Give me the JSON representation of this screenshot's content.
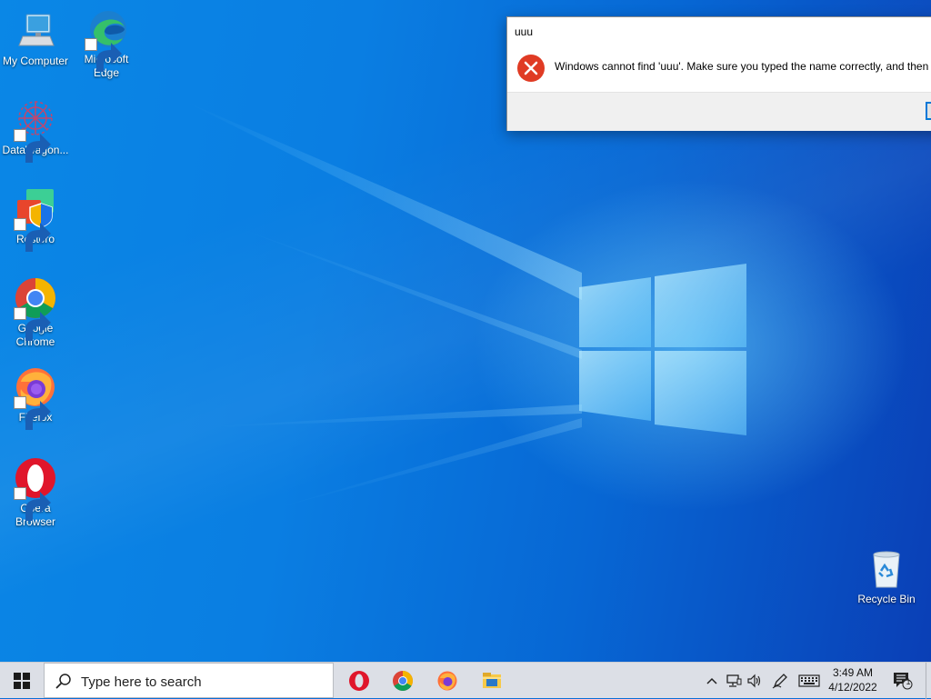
{
  "desktop": {
    "icons": [
      {
        "label": "My Computer",
        "icon": "computer-icon"
      },
      {
        "label": "Microsoft Edge",
        "icon": "edge-icon"
      },
      {
        "label": "DataWagon...",
        "icon": "datawagon-icon"
      },
      {
        "label": "Restoro",
        "icon": "restoro-icon"
      },
      {
        "label": "Google Chrome",
        "icon": "chrome-icon"
      },
      {
        "label": "Firefox",
        "icon": "firefox-icon"
      },
      {
        "label": "Opera Browser",
        "icon": "opera-icon"
      },
      {
        "label": "Recycle Bin",
        "icon": "recycle-bin-icon"
      }
    ]
  },
  "dialog": {
    "title": "uuu",
    "message": "Windows cannot find 'uuu'. Make sure you typed the name correctly, and then",
    "icon": "error-icon"
  },
  "taskbar": {
    "search_placeholder": "Type here to search",
    "apps": [
      "opera-icon",
      "chrome-icon",
      "firefox-icon",
      "file-explorer-icon"
    ],
    "tray": {
      "time": "3:49 AM",
      "date": "4/12/2022",
      "notification_count": "1"
    }
  },
  "colors": {
    "desktop_blue": "#0a6fd8",
    "error_red": "#e03b24",
    "accent": "#0078d7"
  }
}
